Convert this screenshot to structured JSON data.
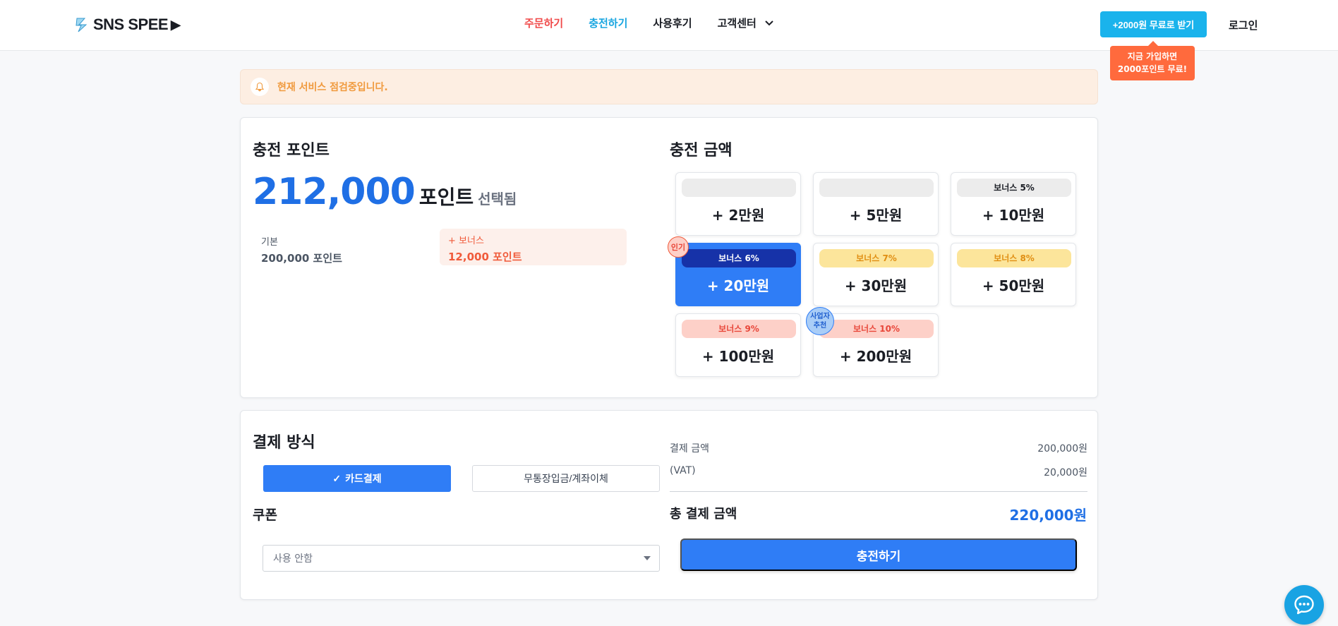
{
  "header": {
    "logo_text": "SNS SPEE",
    "nav": [
      {
        "label": "주문하기"
      },
      {
        "label": "충전하기"
      },
      {
        "label": "사용후기"
      },
      {
        "label": "고객센터"
      }
    ],
    "promo_button": "+2000원 무료로 받기",
    "login": "로그인",
    "tooltip_line1": "지금 가입하면",
    "tooltip_line2": "2000포인트 무료!"
  },
  "notice": {
    "text": "현재 서비스 점검중입니다."
  },
  "charge_points": {
    "title": "충전 포인트",
    "total": "212,000",
    "unit": "포인트",
    "selected_label": "선택됨",
    "base_label": "기본",
    "base_value": "200,000 포인트",
    "bonus_label": "+ 보너스",
    "bonus_value": "12,000 포인트"
  },
  "charge_amount": {
    "title": "충전 금액",
    "options": [
      {
        "tag": "",
        "amount": "+ 2만원"
      },
      {
        "tag": "",
        "amount": "+ 5만원"
      },
      {
        "tag": "보너스 5%",
        "amount": "+ 10만원"
      },
      {
        "tag": "보너스 6%",
        "amount": "+ 20만원",
        "badge": "인기"
      },
      {
        "tag": "보너스 7%",
        "amount": "+ 30만원"
      },
      {
        "tag": "보너스 8%",
        "amount": "+ 50만원"
      },
      {
        "tag": "보너스 9%",
        "amount": "+ 100만원"
      },
      {
        "tag": "보너스 10%",
        "amount": "+ 200만원",
        "badge_line1": "사업자",
        "badge_line2": "추천"
      }
    ],
    "selected_index": 3
  },
  "payment": {
    "title": "결제 방식",
    "methods": [
      {
        "label": "카드결제",
        "selected": true
      },
      {
        "label": "무통장입금/계좌이체",
        "selected": false
      }
    ],
    "coupon_title": "쿠폰",
    "coupon_value": "사용 안함",
    "amount_label": "결제 금액",
    "amount_value": "200,000원",
    "vat_label": "(VAT)",
    "vat_value": "20,000원",
    "total_label": "총 결제 금액",
    "total_value": "220,000원",
    "charge_button": "충전하기"
  },
  "colors": {
    "primary": "#2f7df6",
    "accent_red": "#f04a4a",
    "accent_sky": "#1ab3ec",
    "notice_bg": "#fdeee2"
  }
}
